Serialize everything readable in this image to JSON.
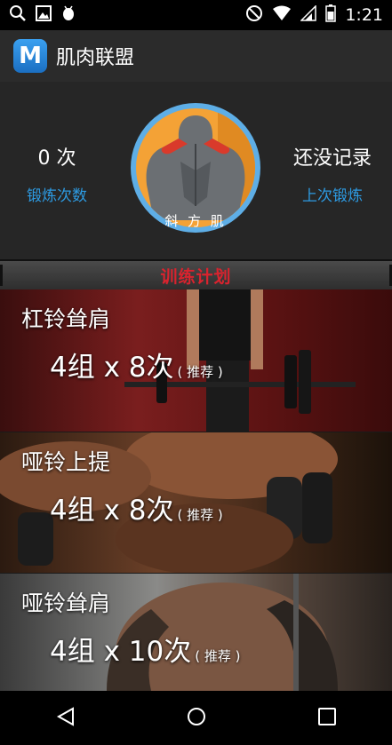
{
  "status_bar": {
    "time": "1:21"
  },
  "app": {
    "title": "肌肉联盟",
    "logo_letter": "M"
  },
  "stats": {
    "count_value": "0 次",
    "count_label": "锻炼次数",
    "last_value": "还没记录",
    "last_label": "上次锻炼"
  },
  "muscle": {
    "name": "斜 方 肌"
  },
  "plan": {
    "title": "训练计划"
  },
  "exercises": [
    {
      "name": "杠铃耸肩",
      "sets": "4组 x 8次",
      "note": "( 推荐 )"
    },
    {
      "name": "哑铃上提",
      "sets": "4组 x 8次",
      "note": "( 推荐 )"
    },
    {
      "name": "哑铃耸肩",
      "sets": "4组 x 10次",
      "note": "( 推荐 )"
    }
  ],
  "colors": {
    "accent_blue": "#2d9be3",
    "plan_red": "#d9232e",
    "avatar_orange": "#f4a236"
  }
}
